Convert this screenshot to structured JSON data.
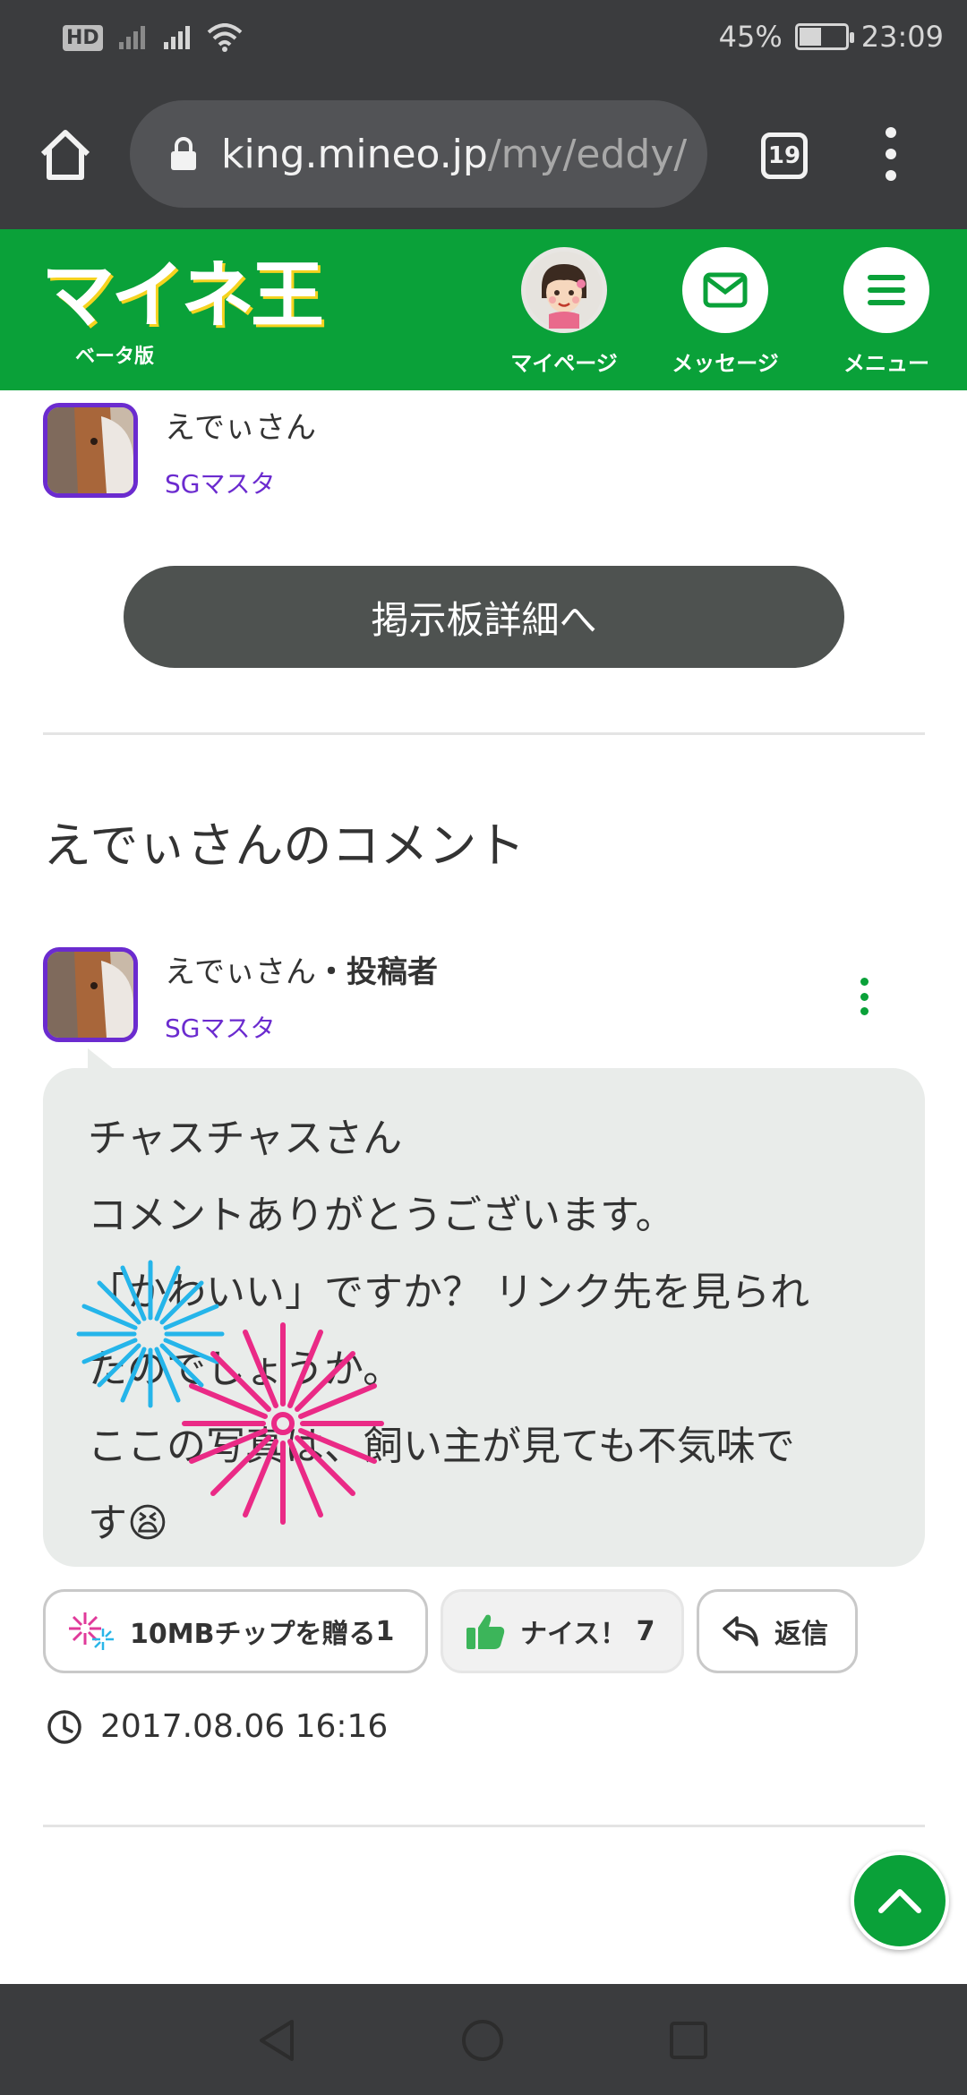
{
  "status_bar": {
    "hd_label": "HD",
    "battery": "45%",
    "time": "23:09"
  },
  "browser": {
    "url_host": "king.mineo.jp",
    "url_path": "/my/eddy/",
    "tab_count": "19"
  },
  "site_header": {
    "logo_text": "マイネ王",
    "logo_sub": "ベータ版",
    "nav": {
      "mypage": "マイページ",
      "message": "メッセージ",
      "menu": "メニュー"
    }
  },
  "top_user": {
    "name": "えでぃさん",
    "rank": "SGマスタ"
  },
  "board_button": "掲示板詳細へ",
  "section_title": "えでぃさんのコメント",
  "comment": {
    "author": "えでぃさん",
    "author_suffix": "・投稿者",
    "rank": "SGマスタ",
    "lines": [
      "チャスチャスさん",
      "コメントありがとうございます。",
      "「かわいい」ですか？ リンク先を見られ",
      "たのでしょうか。",
      "ここの写真は、飼い主が見ても不気味で",
      "す"
    ],
    "emoji": "😫",
    "actions": {
      "tip": "10MBチップを贈る",
      "tip_count": "1",
      "nice": "ナイス！",
      "nice_count": "7",
      "reply": "返信"
    },
    "timestamp": "2017.08.06 16:16"
  },
  "colors": {
    "brand_green": "#0aa139",
    "rank_purple": "#6b2bcf",
    "chrome_dark": "#3b3c3e"
  }
}
